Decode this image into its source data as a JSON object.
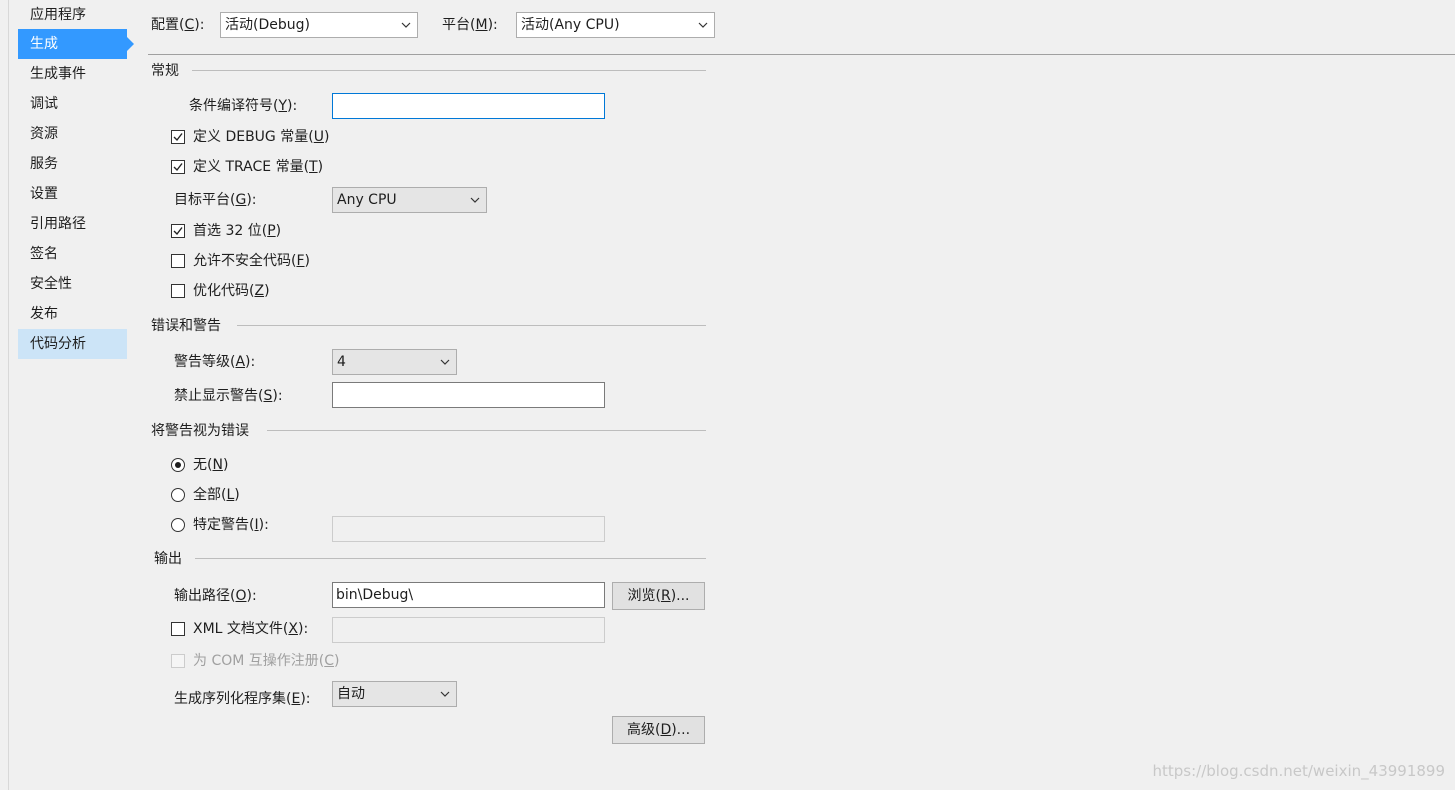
{
  "sidebar": {
    "items": [
      {
        "label": "应用程序"
      },
      {
        "label": "生成"
      },
      {
        "label": "生成事件"
      },
      {
        "label": "调试"
      },
      {
        "label": "资源"
      },
      {
        "label": "服务"
      },
      {
        "label": "设置"
      },
      {
        "label": "引用路径"
      },
      {
        "label": "签名"
      },
      {
        "label": "安全性"
      },
      {
        "label": "发布"
      },
      {
        "label": "代码分析"
      }
    ]
  },
  "header": {
    "config_label": "配置(",
    "config_key": "C",
    "config_suffix": "):",
    "config_value": "活动(Debug)",
    "platform_label": "平台(",
    "platform_key": "M",
    "platform_suffix": "):",
    "platform_value": "活动(Any CPU)"
  },
  "general": {
    "title": "常规",
    "cond_symbols_label": "条件编译符号(",
    "cond_symbols_key": "Y",
    "cond_symbols_suffix": "):",
    "cond_symbols_value": "",
    "define_debug_label": "定义 DEBUG 常量(",
    "define_debug_key": "U",
    "define_debug_suffix": ")",
    "define_debug_checked": true,
    "define_trace_label": "定义 TRACE 常量(",
    "define_trace_key": "T",
    "define_trace_suffix": ")",
    "define_trace_checked": true,
    "target_platform_label": "目标平台(",
    "target_platform_key": "G",
    "target_platform_suffix": "):",
    "target_platform_value": "Any CPU",
    "prefer32_label": "首选 32 位(",
    "prefer32_key": "P",
    "prefer32_suffix": ")",
    "prefer32_checked": true,
    "unsafe_label": "允许不安全代码(",
    "unsafe_key": "F",
    "unsafe_suffix": ")",
    "unsafe_checked": false,
    "optimize_label": "优化代码(",
    "optimize_key": "Z",
    "optimize_suffix": ")",
    "optimize_checked": false
  },
  "errors": {
    "title": "错误和警告",
    "warning_level_label": "警告等级(",
    "warning_level_key": "A",
    "warning_level_suffix": "):",
    "warning_level_value": "4",
    "suppress_label": "禁止显示警告(",
    "suppress_key": "S",
    "suppress_suffix": "):",
    "suppress_value": ""
  },
  "treat_warnings": {
    "title": "将警告视为错误",
    "none_label": "无(",
    "none_key": "N",
    "none_suffix": ")",
    "all_label": "全部(",
    "all_key": "L",
    "all_suffix": ")",
    "specific_label": "特定警告(",
    "specific_key": "I",
    "specific_suffix": "):",
    "specific_value": "",
    "selected": "none"
  },
  "output": {
    "title": "输出",
    "path_label": "输出路径(",
    "path_key": "O",
    "path_suffix": "):",
    "path_value": "bin\\Debug\\",
    "browse_label": "浏览(",
    "browse_key": "R",
    "browse_suffix": ")...",
    "xml_label": "XML 文档文件(",
    "xml_key": "X",
    "xml_suffix": "):",
    "xml_checked": false,
    "xml_value": "",
    "com_label": "为 COM 互操作注册(",
    "com_key": "C",
    "com_suffix": ")",
    "com_checked": false,
    "serialization_label": "生成序列化程序集(",
    "serialization_key": "E",
    "serialization_suffix": "):",
    "serialization_value": "自动",
    "advanced_label": "高级(",
    "advanced_key": "D",
    "advanced_suffix": ")..."
  },
  "watermark": "https://blog.csdn.net/weixin_43991899"
}
